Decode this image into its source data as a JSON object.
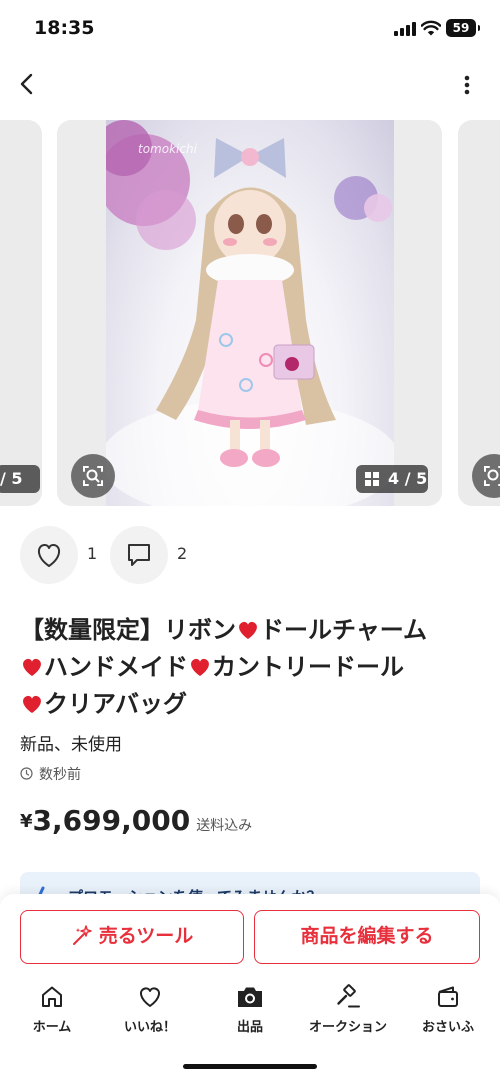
{
  "status_bar": {
    "time": "18:35",
    "battery": "59"
  },
  "item": {
    "watermark": "tomokichi",
    "image_pager": "4 / 5",
    "prev_pager": "/ 5",
    "likes_count": "1",
    "comments_count": "2",
    "title_parts": [
      "【数量限定】リボン",
      "ドールチャーム",
      "ハンドメイド",
      "カントリードール",
      "クリアバッグ"
    ],
    "condition": "新品、未使用",
    "posted": "数秒前",
    "price_currency": "¥",
    "price": "3,699,000",
    "shipping": "送料込み"
  },
  "promo": {
    "text": "プロモーションを使ってみませんか？"
  },
  "actions": {
    "sell_tool": "売るツール",
    "edit_item": "商品を編集する"
  },
  "tabbar": {
    "items": [
      {
        "label": "ホーム",
        "icon": "home-icon"
      },
      {
        "label": "いいね！",
        "icon": "heart-icon"
      },
      {
        "label": "出品",
        "icon": "camera-icon"
      },
      {
        "label": "オークション",
        "icon": "gavel-icon"
      },
      {
        "label": "おさいふ",
        "icon": "wallet-icon"
      }
    ]
  },
  "colors": {
    "accent": "#e8303c",
    "emoji_heart": "#e0202e",
    "promo_bg": "#e9f1fb"
  }
}
